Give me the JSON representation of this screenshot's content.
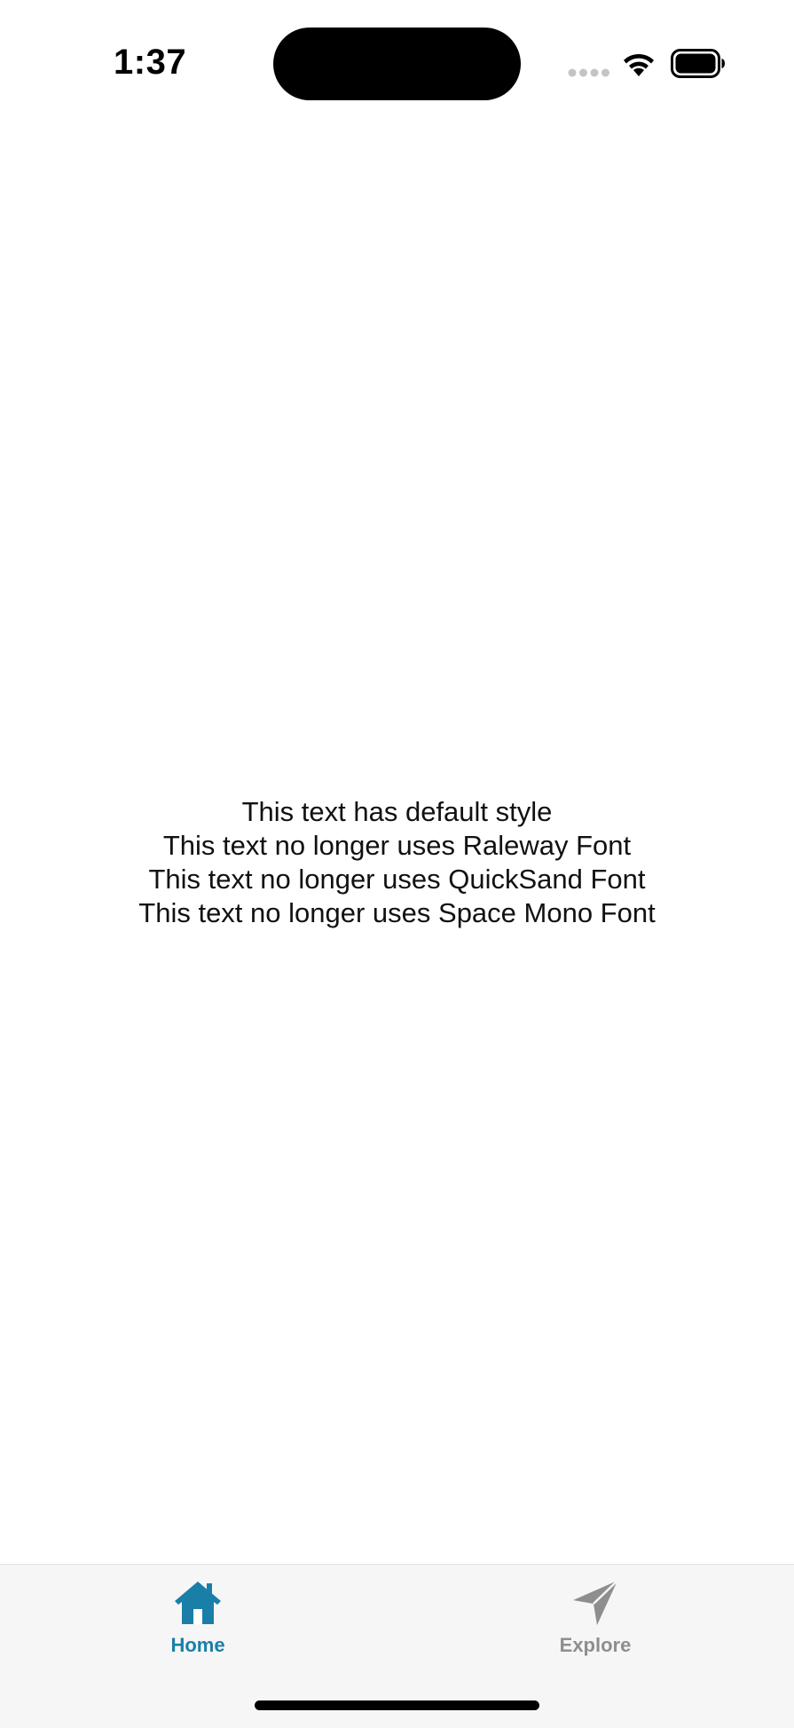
{
  "status_bar": {
    "time": "1:37",
    "signal_icon": "signal-dots-icon",
    "wifi_icon": "wifi-icon",
    "battery_icon": "battery-icon"
  },
  "content": {
    "lines": [
      "This text has default style",
      "This text no longer uses Raleway Font",
      "This text no longer uses QuickSand Font",
      "This text no longer uses Space Mono Font"
    ]
  },
  "tab_bar": {
    "tabs": [
      {
        "label": "Home",
        "icon": "home-icon",
        "active": true
      },
      {
        "label": "Explore",
        "icon": "paper-plane-icon",
        "active": false
      }
    ]
  },
  "colors": {
    "accent": "#1a7fa8",
    "inactive": "#8e8e8e",
    "tab_bar_bg": "#f6f6f6"
  }
}
